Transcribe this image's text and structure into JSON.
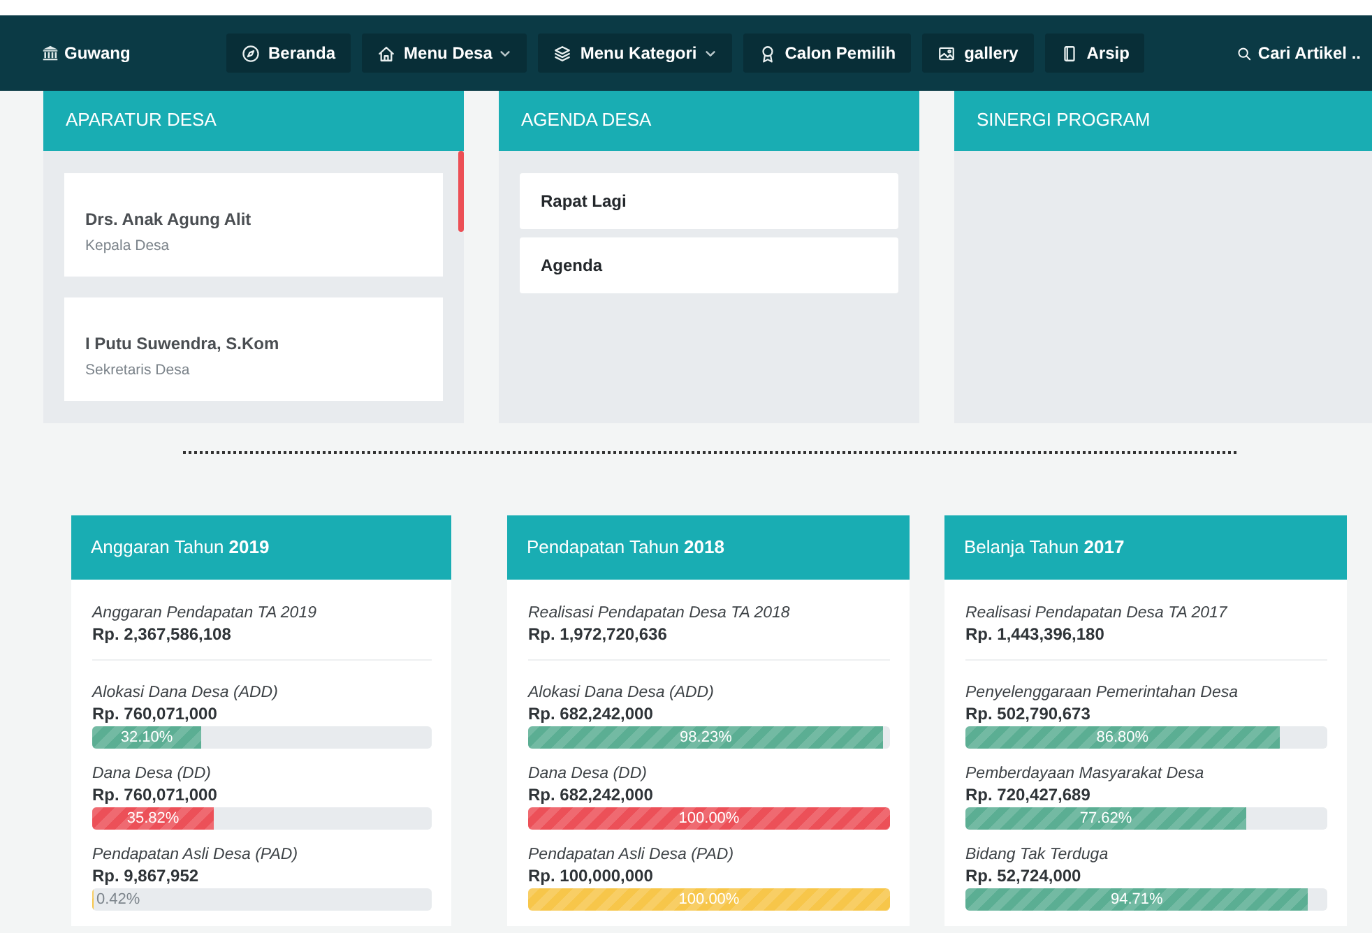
{
  "navbar": {
    "brand": "Guwang",
    "items": [
      {
        "label": "Beranda",
        "dropdown": false
      },
      {
        "label": "Menu Desa",
        "dropdown": true
      },
      {
        "label": "Menu Kategori",
        "dropdown": true
      },
      {
        "label": "Calon Pemilih",
        "dropdown": false
      },
      {
        "label": "gallery",
        "dropdown": false
      },
      {
        "label": "Arsip",
        "dropdown": false
      }
    ],
    "search": "Cari Artikel .."
  },
  "panels": [
    {
      "title": "APARATUR DESA",
      "kind": "people",
      "items": [
        {
          "name": "Drs. Anak Agung Alit",
          "role": "Kepala Desa"
        },
        {
          "name": "I Putu Suwendra, S.Kom",
          "role": "Sekretaris Desa"
        }
      ]
    },
    {
      "title": "AGENDA DESA",
      "kind": "agenda",
      "items": [
        {
          "name": "Rapat Lagi"
        },
        {
          "name": "Agenda"
        }
      ]
    },
    {
      "title": "SINERGI PROGRAM",
      "kind": "empty"
    }
  ],
  "budget_cards": [
    {
      "title": "Anggaran Tahun **2019**",
      "total_label": "Anggaran Pendapatan TA 2019",
      "total_value": "Rp. 2,367,586,108",
      "items": [
        {
          "label": "Alokasi Dana Desa (ADD)",
          "value": "Rp. 760,071,000",
          "level": 0.321,
          "percent": "32.10%",
          "color": "#5bae93"
        },
        {
          "label": "Dana Desa (DD)",
          "value": "Rp. 760,071,000",
          "level": 0.3582,
          "percent": "35.82%",
          "color": "#ec5058"
        },
        {
          "label": "Pendapatan Asli Desa (PAD)",
          "value": "Rp. 9,867,952",
          "level": 0.0042,
          "percent": "0.42%",
          "color": "#f7c64a"
        }
      ]
    },
    {
      "title": "Pendapatan Tahun **2018**",
      "total_label": "Realisasi Pendapatan Desa TA 2018",
      "total_value": "Rp. 1,972,720,636",
      "items": [
        {
          "label": "Alokasi Dana Desa (ADD)",
          "value": "Rp. 682,242,000",
          "level": 0.9823,
          "percent": "98.23%",
          "color": "#5bae93"
        },
        {
          "label": "Dana Desa (DD)",
          "value": "Rp. 682,242,000",
          "level": 1.0,
          "percent": "100.00%",
          "color": "#ec5058"
        },
        {
          "label": "Pendapatan Asli Desa (PAD)",
          "value": "Rp. 100,000,000",
          "level": 1.0,
          "percent": "100.00%",
          "color": "#f7c64a"
        }
      ]
    },
    {
      "title": "Belanja Tahun **2017**",
      "total_label": "Realisasi Pendapatan Desa TA 2017",
      "total_value": "Rp. 1,443,396,180",
      "items": [
        {
          "label": "Penyelenggaraan Pemerintahan Desa",
          "value": "Rp. 502,790,673",
          "level": 0.868,
          "percent": "86.80%",
          "color": "#5bae93"
        },
        {
          "label": "Pemberdayaan Masyarakat Desa",
          "value": "Rp. 720,427,689",
          "level": 0.7762,
          "percent": "77.62%",
          "color": "#5bae93"
        },
        {
          "label": "Bidang Tak Terduga",
          "value": "Rp. 52,724,000",
          "level": 0.9471,
          "percent": "94.71%",
          "color": "#5bae93"
        }
      ]
    }
  ]
}
